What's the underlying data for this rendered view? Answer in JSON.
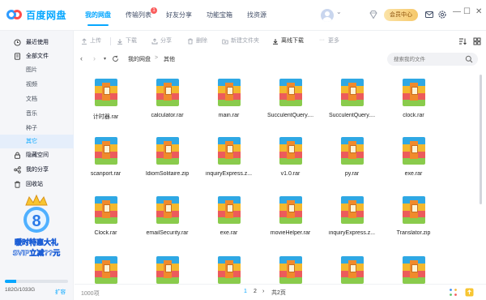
{
  "header": {
    "app_name": "百度网盘",
    "nav": [
      {
        "label": "我的网盘",
        "active": true
      },
      {
        "label": "传输列表",
        "badge": "1"
      },
      {
        "label": "好友分享"
      },
      {
        "label": "功能宝箱"
      },
      {
        "label": "找资源"
      }
    ],
    "user_caret": "⌄",
    "member_center": "会员中心"
  },
  "sidebar": {
    "items": [
      {
        "label": "最近使用",
        "icon": "clock-icon"
      },
      {
        "label": "全部文件",
        "icon": "file-icon"
      },
      {
        "label": "图片",
        "sub": true
      },
      {
        "label": "视频",
        "sub": true
      },
      {
        "label": "文档",
        "sub": true
      },
      {
        "label": "音乐",
        "sub": true
      },
      {
        "label": "种子",
        "sub": true
      },
      {
        "label": "其它",
        "sub": true,
        "active": true
      },
      {
        "label": "隐藏空间",
        "icon": "lock-icon"
      },
      {
        "label": "我的分享",
        "icon": "share-icon"
      },
      {
        "label": "回收站",
        "icon": "trash-icon"
      }
    ],
    "promo_line1": "暖时特惠大礼",
    "promo_line2": "SVIP立减??元",
    "storage_text": "182G/1033G",
    "storage_fraction": 0.176,
    "expand_label": "扩容"
  },
  "toolbar": {
    "upload": "上传",
    "download": "下载",
    "share": "分享",
    "delete": "删除",
    "new_folder": "新建文件夹",
    "offline_download": "离线下载",
    "more": "更多"
  },
  "address": {
    "crumbs": [
      "我的网盘",
      "其他"
    ],
    "search_placeholder": "搜索我的文件"
  },
  "files": [
    "计时器.rar",
    "calculator.rar",
    "main.rar",
    "SucculentQuery....",
    "SucculentQuery....",
    "clock.rar",
    "scanport.rar",
    "IdiomSolitaire.zip",
    "inquiryExpress.z...",
    "v1.0.rar",
    "py.rar",
    "exe.rar",
    "Clock.rar",
    "emailSecurity.rar",
    "exe.rar",
    "movieHelper.rar",
    "inquiryExpress.z...",
    "Translator.zip",
    "",
    "",
    "",
    "",
    "",
    ""
  ],
  "status": {
    "count": "1000项",
    "page1": "1",
    "page2": "2",
    "next": "›",
    "total_pages": "共2页"
  },
  "colors": {
    "accent": "#06a7ff",
    "sidebar_bg": "#f5f6f9",
    "active_bg": "#e5eefb"
  }
}
